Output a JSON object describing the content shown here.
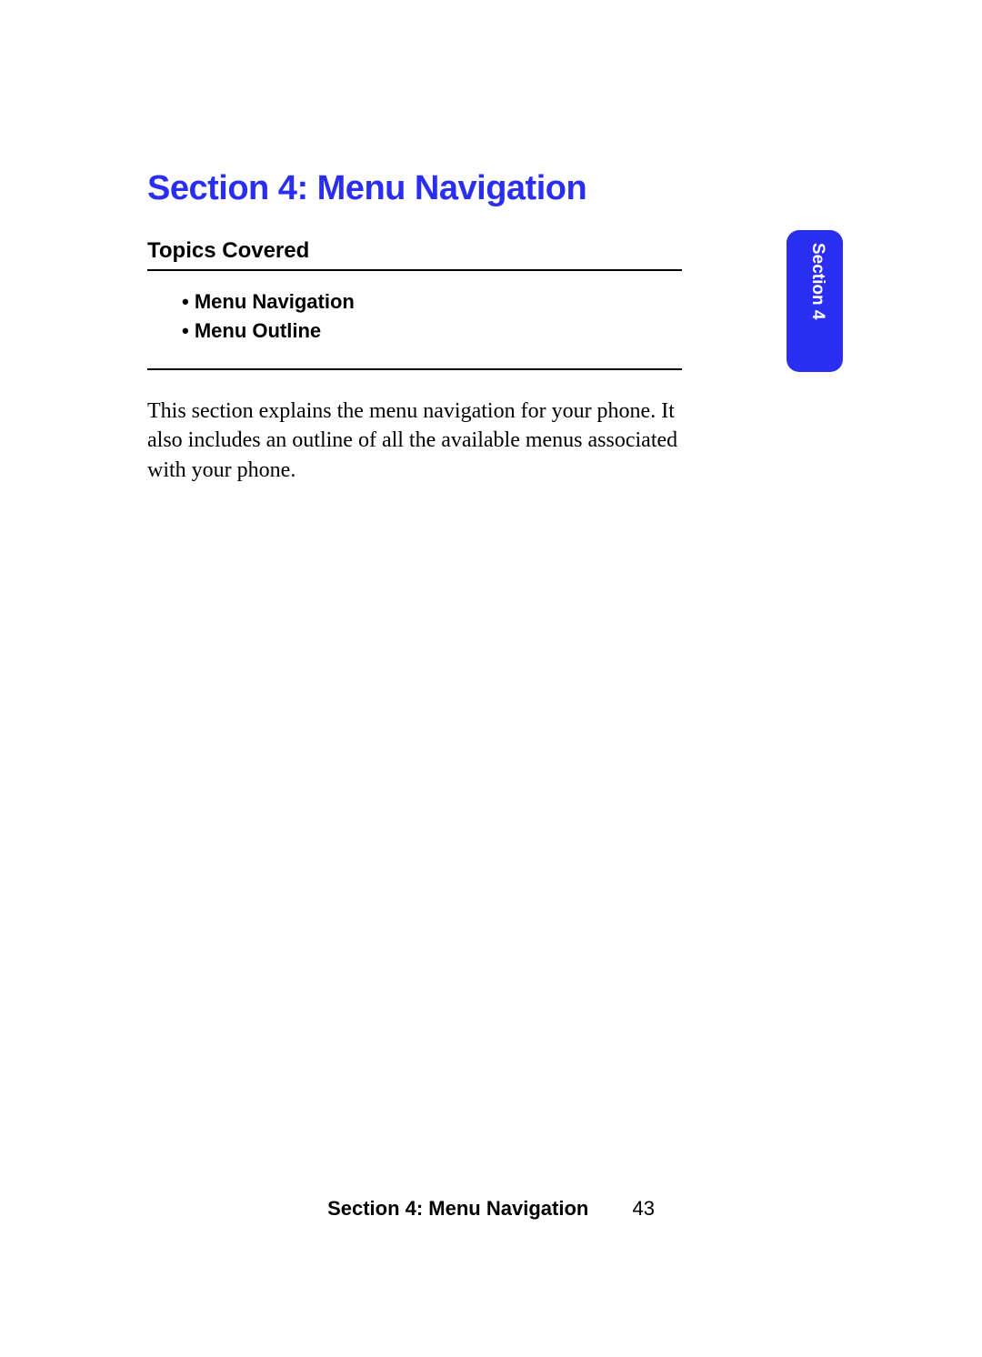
{
  "title": "Section 4: Menu Navigation",
  "tab_label": "Section 4",
  "topics_heading": "Topics Covered",
  "topics": {
    "item1": "Menu Navigation",
    "item2": "Menu Outline"
  },
  "body": "This section explains the menu navigation for your phone. It also includes an outline of all the available menus associated with your phone.",
  "footer": {
    "section": "Section 4: Menu Navigation",
    "page": "43"
  }
}
